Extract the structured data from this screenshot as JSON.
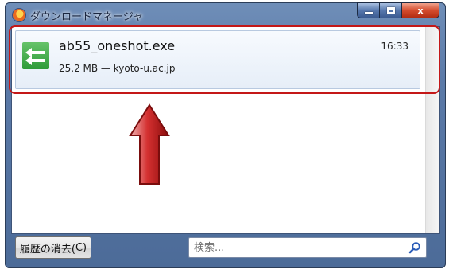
{
  "window": {
    "title": "ダウンロードマネージャ",
    "caption_close": "x"
  },
  "download": {
    "file_name": "ab55_oneshot.exe",
    "meta": "25.2 MB — kyoto-u.ac.jp",
    "time": "16:33"
  },
  "toolbar": {
    "clear_label_prefix": "履歴の消去(",
    "clear_label_key": "C",
    "clear_label_suffix": ")"
  },
  "search": {
    "placeholder": "検索..."
  },
  "colors": {
    "highlight": "#c41818",
    "arrow_fill": "#c01d1d",
    "file_icon": "#3aa845"
  }
}
